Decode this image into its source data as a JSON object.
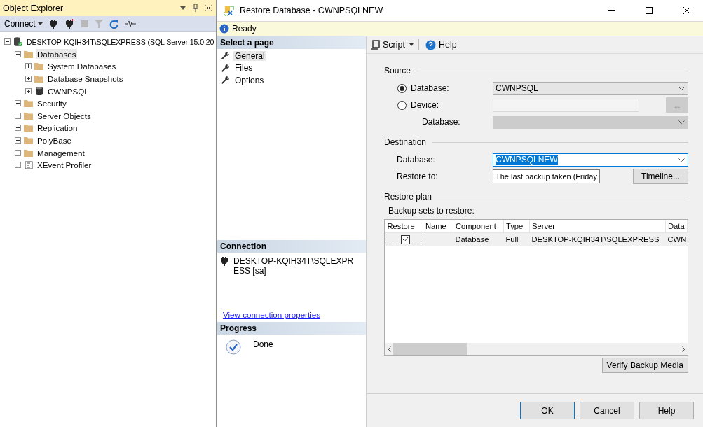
{
  "object_explorer": {
    "title": "Object Explorer",
    "connect_button": "Connect",
    "tree": [
      {
        "label": "DESKTOP-KQIH34T\\SQLEXPRESS (SQL Server 15.0.20",
        "kind": "server",
        "expanded": true,
        "selected": false,
        "children": [
          {
            "label": "Databases",
            "kind": "folder",
            "expanded": true,
            "selected": true,
            "children": [
              {
                "label": "System Databases",
                "kind": "folder",
                "expanded": false,
                "selected": false
              },
              {
                "label": "Database Snapshots",
                "kind": "folder",
                "expanded": false,
                "selected": false
              },
              {
                "label": "CWNPSQL",
                "kind": "database",
                "expanded": false,
                "selected": false
              }
            ]
          },
          {
            "label": "Security",
            "kind": "folder",
            "expanded": false,
            "selected": false
          },
          {
            "label": "Server Objects",
            "kind": "folder",
            "expanded": false,
            "selected": false
          },
          {
            "label": "Replication",
            "kind": "folder",
            "expanded": false,
            "selected": false
          },
          {
            "label": "PolyBase",
            "kind": "folder",
            "expanded": false,
            "selected": false
          },
          {
            "label": "Management",
            "kind": "folder",
            "expanded": false,
            "selected": false
          },
          {
            "label": "XEvent Profiler",
            "kind": "xevent",
            "expanded": false,
            "selected": false
          }
        ]
      }
    ]
  },
  "dialog": {
    "title": "Restore Database - CWNPSQLNEW",
    "status": "Ready",
    "select_page": {
      "heading": "Select a page",
      "pages": [
        {
          "label": "General",
          "selected": true
        },
        {
          "label": "Files",
          "selected": false
        },
        {
          "label": "Options",
          "selected": false
        }
      ]
    },
    "connection": {
      "heading": "Connection",
      "server": "DESKTOP-KQIH34T\\SQLEXPRESS [sa]",
      "link": "View connection properties"
    },
    "progress": {
      "heading": "Progress",
      "status": "Done"
    },
    "toolbar": {
      "script": "Script",
      "help": "Help"
    },
    "source": {
      "heading": "Source",
      "database_option": {
        "label": "Database:",
        "selected": true,
        "value": "CWNPSQL"
      },
      "device_option": {
        "label": "Device:",
        "selected": false
      },
      "browse_button": "...",
      "device_database_label": "Database:"
    },
    "destination": {
      "heading": "Destination",
      "database_label": "Database:",
      "database_value": "CWNPSQLNEW",
      "restore_to_label": "Restore to:",
      "restore_to_value": "The last backup taken (Friday",
      "timeline_button": "Timeline..."
    },
    "restore_plan": {
      "heading": "Restore plan",
      "backup_sets_label": "Backup sets to restore:",
      "columns": [
        "Restore",
        "Name",
        "Component",
        "Type",
        "Server",
        "Data"
      ],
      "rows": [
        {
          "checked": true,
          "component": "Database",
          "type": "Full",
          "server": "DESKTOP-KQIH34T\\SQLEXPRESS",
          "column_6": "CWN"
        }
      ]
    },
    "verify_button": "Verify Backup Media",
    "buttons": [
      "OK",
      "Cancel",
      "Help"
    ]
  }
}
